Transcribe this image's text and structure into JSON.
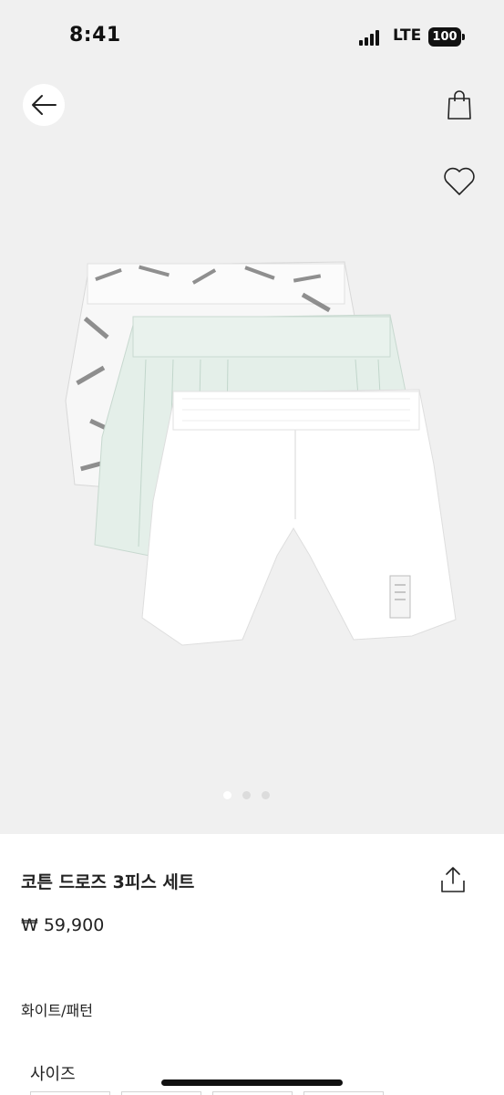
{
  "status_bar": {
    "time": "8:41",
    "network": "LTE",
    "battery": "100"
  },
  "gallery": {
    "image_count": 3,
    "active_index": 0
  },
  "product": {
    "name": "코튼 드로즈 3피스 세트",
    "price": "₩ 59,900",
    "color": "화이트/패턴",
    "size_label": "사이즈"
  },
  "icons": [
    "back-arrow-icon",
    "shopping-bag-icon",
    "heart-icon",
    "share-icon"
  ],
  "colors": {
    "gallery_bg": "#f0f0f0",
    "text": "#222222"
  }
}
